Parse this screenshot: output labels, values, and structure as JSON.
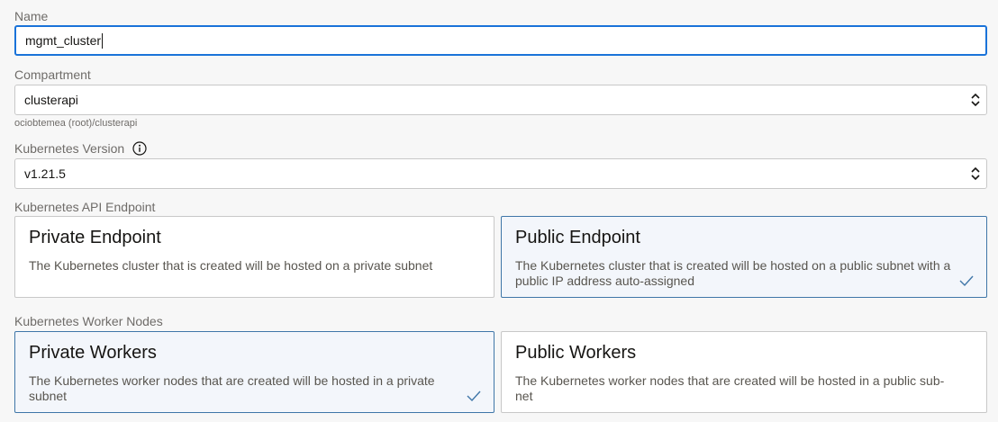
{
  "name": {
    "label": "Name",
    "value": "mgmt_cluster"
  },
  "compartment": {
    "label": "Compartment",
    "value": "clusterapi",
    "path_hint": "ociobtemea (root)/clusterapi"
  },
  "kubernetes_version": {
    "label": "Kubernetes Version",
    "value": "v1.21.5"
  },
  "api_endpoint": {
    "label": "Kubernetes API Endpoint",
    "options": [
      {
        "title": "Private Endpoint",
        "description": "The Kubernetes cluster that is created will be hosted on a private subnet",
        "selected": false
      },
      {
        "title": "Public Endpoint",
        "description": "The Kubernetes cluster that is created will be hosted on a public subnet with a public IP address auto-assigned",
        "selected": true
      }
    ]
  },
  "worker_nodes": {
    "label": "Kubernetes Worker Nodes",
    "options": [
      {
        "title": "Private Workers",
        "description": "The Kubernetes worker nodes that are created will be hosted in a private subnet",
        "selected": true
      },
      {
        "title": "Public Workers",
        "description": "The Kubernetes worker nodes that are created will be hosted in a public sub-net",
        "selected": false
      }
    ]
  },
  "colors": {
    "focus_border": "#1a73d9",
    "selected_border": "#3f76a8",
    "selected_bg": "#f3f6fb",
    "check": "#3f76a8"
  },
  "icons": {
    "info": "info-icon",
    "select": "chevron-updown-icon",
    "check": "checkmark-icon"
  }
}
